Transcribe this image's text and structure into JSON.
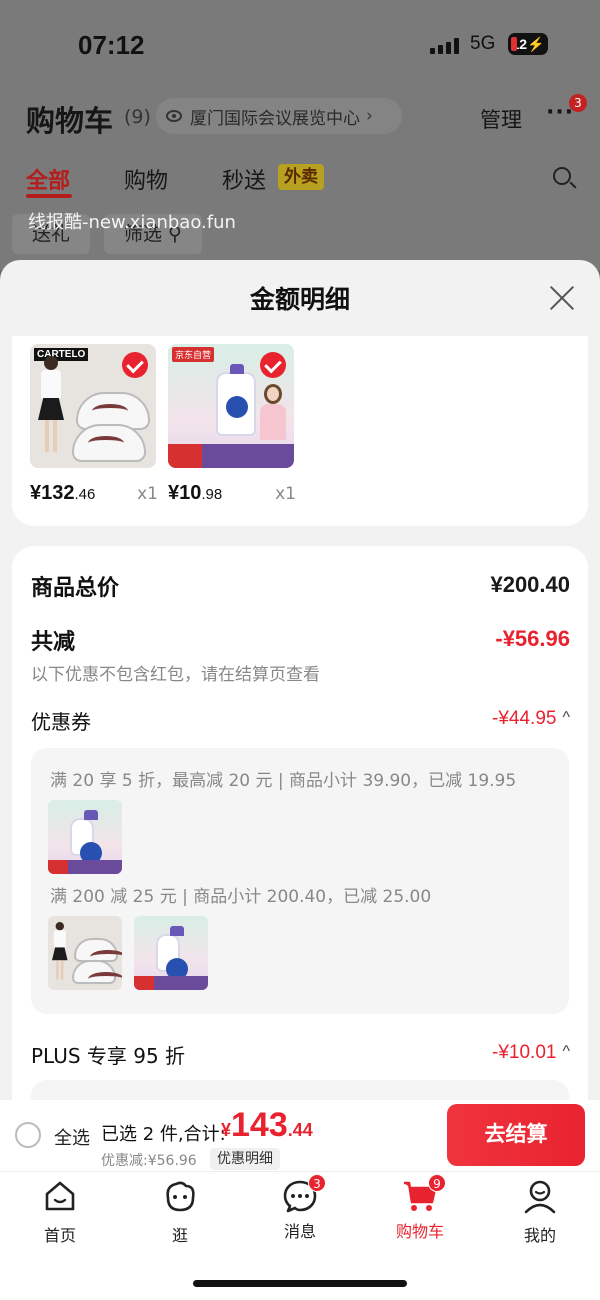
{
  "status_bar": {
    "time": "07:12",
    "network": "5G",
    "battery": "12"
  },
  "header": {
    "title": "购物车",
    "count": "(9)",
    "location": "厦门国际会议展览中心",
    "manage": "管理",
    "more_badge": "3"
  },
  "tabs": [
    {
      "label": "全部"
    },
    {
      "label": "购物"
    },
    {
      "label": "秒送"
    }
  ],
  "takeout_tag": "外卖",
  "filter_chips": [
    {
      "label": "送礼"
    },
    {
      "label": "筛选"
    }
  ],
  "watermark": "线报酷-new.xianbao.fun",
  "sheet": {
    "title": "金额明细",
    "products": [
      {
        "logo": "CARTELO",
        "price_int": "¥132",
        "price_dec": ".46",
        "qty": "x1"
      },
      {
        "tag": "京东自营",
        "price_int": "¥10",
        "price_dec": ".98",
        "qty": "x1"
      }
    ],
    "summary": {
      "total_label": "商品总价",
      "total_value": "¥200.40",
      "reduce_label": "共减",
      "reduce_value": "-¥56.96",
      "note": "以下优惠不包含红包，请在结算页查看",
      "coupon_label": "优惠券",
      "coupon_value": "-¥44.95",
      "coupon_line_1": "满 20 享 5 折，最高减 20 元 | 商品小计 39.90，已减 19.95",
      "coupon_line_2": "满 200 减 25 元 | 商品小计 200.40，已减 25.00",
      "plus_label": "PLUS 专享 95 折",
      "plus_value": "-¥10.01"
    }
  },
  "checkout": {
    "select_all": "全选",
    "selected": "已选 2 件,合计:",
    "currency": "¥",
    "total_int": "143",
    "total_dec": ".44",
    "discount": "优惠减:¥56.96",
    "detail_button": "优惠明细",
    "pay_button": "去结算"
  },
  "tabbar": [
    {
      "label": "首页",
      "icon": "home-icon"
    },
    {
      "label": "逛",
      "icon": "browse-icon"
    },
    {
      "label": "消息",
      "icon": "message-icon",
      "badge": "3"
    },
    {
      "label": "购物车",
      "icon": "cart-icon",
      "badge": "9",
      "active": true
    },
    {
      "label": "我的",
      "icon": "profile-icon"
    }
  ],
  "colors": {
    "accent": "#e8232f",
    "overlay": "#6b6b6b"
  }
}
